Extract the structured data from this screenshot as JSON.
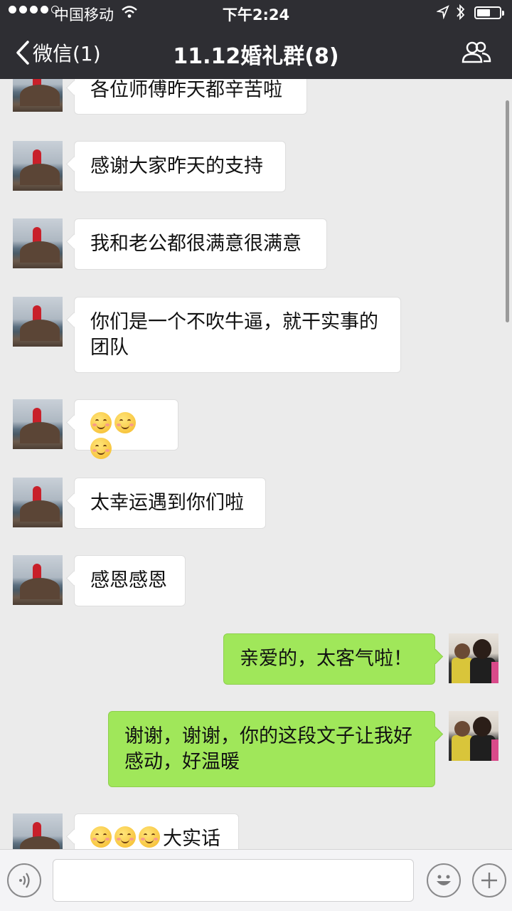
{
  "status_bar": {
    "carrier": "中国移动",
    "time": "下午2:24"
  },
  "nav": {
    "back_label": "微信(1)",
    "title": "11.12婚礼群(8)"
  },
  "messages": [
    {
      "side": "in",
      "text": "各位师傅昨天都辛苦啦"
    },
    {
      "side": "in",
      "text": "感谢大家昨天的支持"
    },
    {
      "side": "in",
      "text": "我和老公都很满意很满意"
    },
    {
      "side": "in",
      "text": "你们是一个不吹牛逼，就干实事的团队"
    },
    {
      "side": "in",
      "emoji_count": 3,
      "text": ""
    },
    {
      "side": "in",
      "text": "太幸运遇到你们啦"
    },
    {
      "side": "in",
      "text": "感恩感恩"
    },
    {
      "side": "out",
      "text": "亲爱的，太客气啦！"
    },
    {
      "side": "out",
      "text": "谢谢，谢谢，你的这段文子让我好感动，好温暖"
    },
    {
      "side": "in",
      "emoji_count": 3,
      "text": "大实话"
    }
  ],
  "input": {
    "value": ""
  },
  "colors": {
    "nav_bg": "#2e2e33",
    "chat_bg": "#ebebeb",
    "outgoing_bubble": "#a0e75a",
    "incoming_bubble": "#ffffff"
  },
  "icons": [
    "chevron-left-icon",
    "group-members-icon",
    "voice-icon",
    "emoji-icon",
    "add-icon",
    "wifi-icon",
    "location-icon",
    "bluetooth-icon",
    "battery-icon"
  ]
}
